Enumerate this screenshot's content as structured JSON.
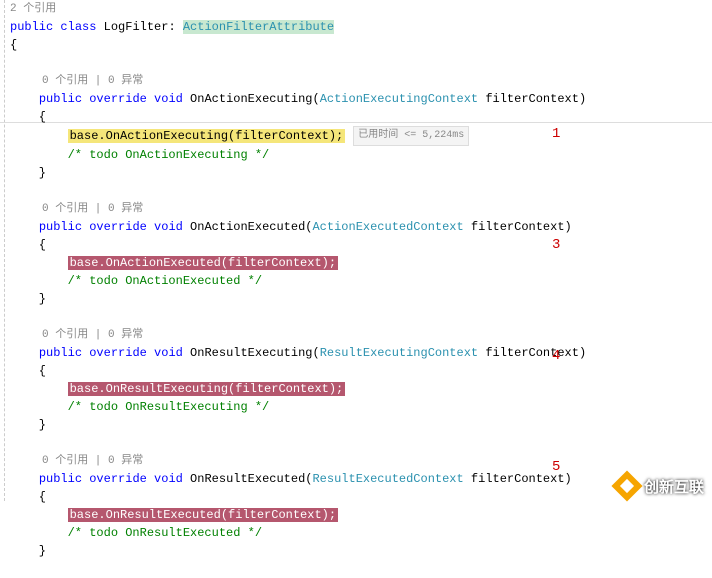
{
  "codelens": {
    "top": "2 个引用",
    "method": "0 个引用 | 0 异常"
  },
  "class_decl": {
    "public": "public",
    "class_kw": "class",
    "name": "LogFilter",
    "colon": ":",
    "base": "ActionFilterAttribute"
  },
  "braces": {
    "open": "{",
    "close": "}"
  },
  "methods": [
    {
      "sig_prefix": "public override void OnActionExecuting(",
      "param_type": "ActionExecutingContext",
      "param_name": " filterContext)",
      "body_stmt": "base.OnActionExecuting(filterContext);",
      "comment": "/* todo OnActionExecuting */",
      "is_current": true,
      "annotation_num": "1"
    },
    {
      "sig_prefix": "public override void OnActionExecuted(",
      "param_type": "ActionExecutedContext",
      "param_name": " filterContext)",
      "body_stmt": "base.OnActionExecuted(filterContext);",
      "comment": "/* todo OnActionExecuted */",
      "is_current": false,
      "annotation_num": "3"
    },
    {
      "sig_prefix": "public override void OnResultExecuting(",
      "param_type": "ResultExecutingContext",
      "param_name": " filterContext)",
      "body_stmt": "base.OnResultExecuting(filterContext);",
      "comment": "/* todo OnResultExecuting */",
      "is_current": false,
      "annotation_num": "4"
    },
    {
      "sig_prefix": "public override void OnResultExecuted(",
      "param_type": "ResultExecutedContext",
      "param_name": " filterContext)",
      "body_stmt": "base.OnResultExecuted(filterContext);",
      "comment": "/* todo OnResultExecuted */",
      "is_current": false,
      "annotation_num": "5"
    }
  ],
  "perf_tip": "已用时间 <= 5,224ms",
  "keywords": {
    "pub": "public",
    "ovr": "override",
    "vd": "void"
  },
  "watermark": "创新互联",
  "chart_data": null
}
